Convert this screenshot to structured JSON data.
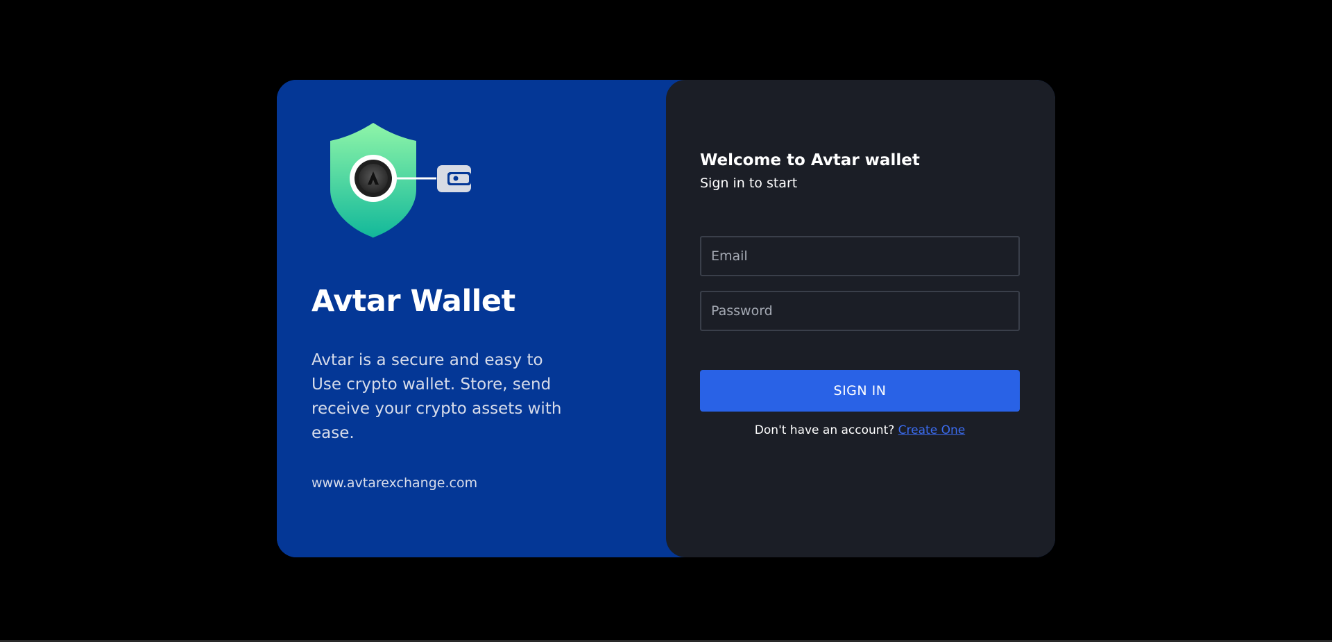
{
  "brand": {
    "name": "Avtar Wallet",
    "description": "Avtar is a secure and easy to Use crypto wallet. Store, send receive your crypto assets with ease.",
    "website": "www.avtarexchange.com",
    "logo_icons": [
      "shield-icon",
      "wallet-icon"
    ]
  },
  "login": {
    "title": "Welcome to Avtar wallet",
    "subtitle": "Sign in to start",
    "email_placeholder": "Email",
    "email_value": "",
    "password_placeholder": "Password",
    "password_value": "",
    "submit_label": "SIGN IN",
    "signup_prompt": "Don't have an account?",
    "signup_link": "Create One"
  },
  "colors": {
    "background": "#000000",
    "brand_panel": "#043796",
    "form_panel": "#1b1e26",
    "accent_button": "#2962e6",
    "link": "#3b6cf0",
    "shield_gradient_top": "#8ff5a8",
    "shield_gradient_bottom": "#12b89a"
  }
}
